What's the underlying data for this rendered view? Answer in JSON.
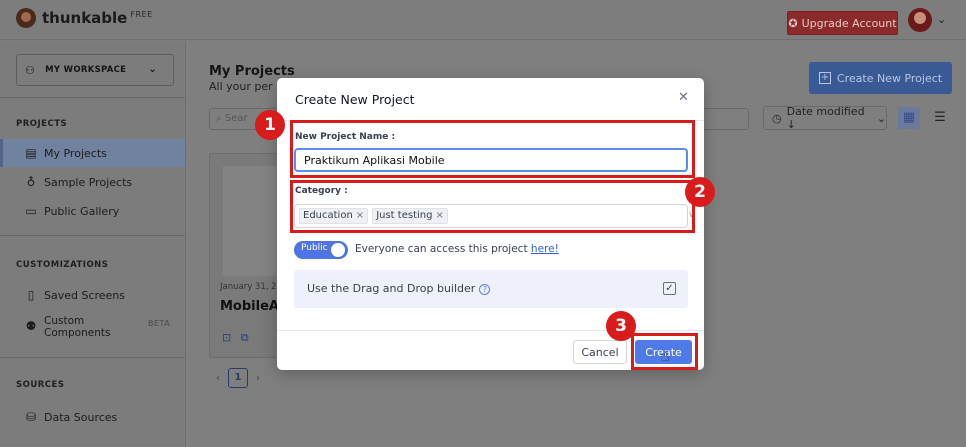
{
  "app": {
    "brand": "thunkable",
    "plan_badge": "FREE",
    "upgrade_label": "Upgrade Account"
  },
  "sidebar": {
    "workspace_label": "MY WORKSPACE",
    "sections": {
      "projects": "PROJECTS",
      "customizations": "CUSTOMIZATIONS",
      "sources": "SOURCES"
    },
    "items": [
      {
        "label": "My Projects",
        "icon": "document-icon"
      },
      {
        "label": "Sample Projects",
        "icon": "badge-icon"
      },
      {
        "label": "Public Gallery",
        "icon": "gallery-icon"
      },
      {
        "label": "Saved Screens",
        "icon": "phone-icon"
      },
      {
        "label": "Custom Components",
        "icon": "components-icon"
      },
      {
        "label": "Data Sources",
        "icon": "database-icon"
      }
    ],
    "beta_badge": "BETA"
  },
  "main": {
    "title": "My Projects",
    "subtitle": "All your per",
    "create_new_label": "Create New Project",
    "search_placeholder": "Sear",
    "sort_label": "Date modified ↓",
    "card": {
      "date": "January 31, 2",
      "name": "MobileA"
    },
    "pagination": {
      "current_page": "1"
    }
  },
  "modal": {
    "title": "Create New Project",
    "name_label": "New Project Name :",
    "name_value": "Praktikum Aplikasi Mobile",
    "category_label": "Category :",
    "categories": [
      "Education",
      "Just testing"
    ],
    "toggle_label": "Public",
    "public_text": "Everyone can access this project",
    "public_link": "here!",
    "dnd_label": "Use the Drag and Drop builder",
    "dnd_checked": true,
    "cancel_label": "Cancel",
    "create_label": "Create"
  },
  "annotations": {
    "step1": "1",
    "step2": "2",
    "step3": "3",
    "highlight_color": "#d81b1b"
  },
  "colors": {
    "primary": "#4f7be8",
    "overlay": "#7f7f7f"
  }
}
